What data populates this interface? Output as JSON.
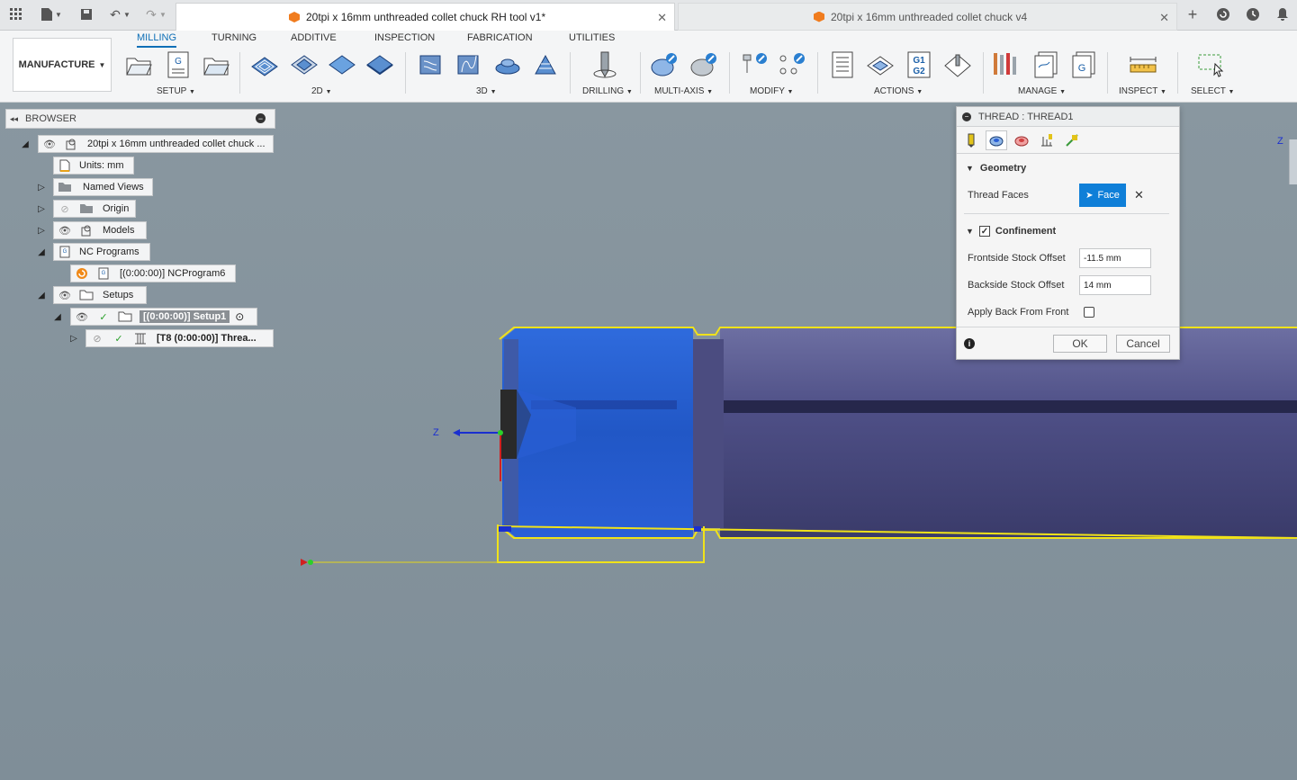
{
  "titlebar": {
    "tabs": [
      {
        "label": "20tpi x 16mm unthreaded collet chuck RH tool v1*",
        "active": true
      },
      {
        "label": "20tpi x 16mm unthreaded collet chuck v4",
        "active": false
      }
    ],
    "icons": [
      "grid-icon",
      "file-icon",
      "save-icon",
      "undo-icon",
      "redo-icon",
      "add-tab-icon",
      "refresh-icon",
      "clock-icon",
      "bell-icon"
    ]
  },
  "ribbon": {
    "workspace": "MANUFACTURE",
    "tabs": [
      "MILLING",
      "TURNING",
      "ADDITIVE",
      "INSPECTION",
      "FABRICATION",
      "UTILITIES"
    ],
    "groups": [
      "SETUP",
      "2D",
      "3D",
      "DRILLING",
      "MULTI-AXIS",
      "MODIFY",
      "ACTIONS",
      "MANAGE",
      "INSPECT",
      "SELECT"
    ]
  },
  "browser": {
    "title": "BROWSER",
    "nodes": {
      "root": "20tpi x 16mm unthreaded collet chuck ...",
      "units": "Units: mm",
      "named_views": "Named Views",
      "origin": "Origin",
      "models": "Models",
      "nc_programs": "NC Programs",
      "nc_program": "[(0:00:00)] NCProgram6",
      "setups": "Setups",
      "setup1": "[(0:00:00)] Setup1",
      "thread_op": "[T8 (0:00:00)] Threa..."
    }
  },
  "dialog": {
    "title": "THREAD : THREAD1",
    "geometry_section": "Geometry",
    "thread_faces_label": "Thread Faces",
    "face_button": "Face",
    "confinement_section": "Confinement",
    "frontside_label": "Frontside Stock Offset",
    "frontside_value": "-11.5 mm",
    "backside_label": "Backside Stock Offset",
    "backside_value": "14 mm",
    "apply_back_label": "Apply Back From Front",
    "ok": "OK",
    "cancel": "Cancel"
  },
  "viewport": {
    "axis_z": "Z",
    "corner_axis": "Z"
  }
}
